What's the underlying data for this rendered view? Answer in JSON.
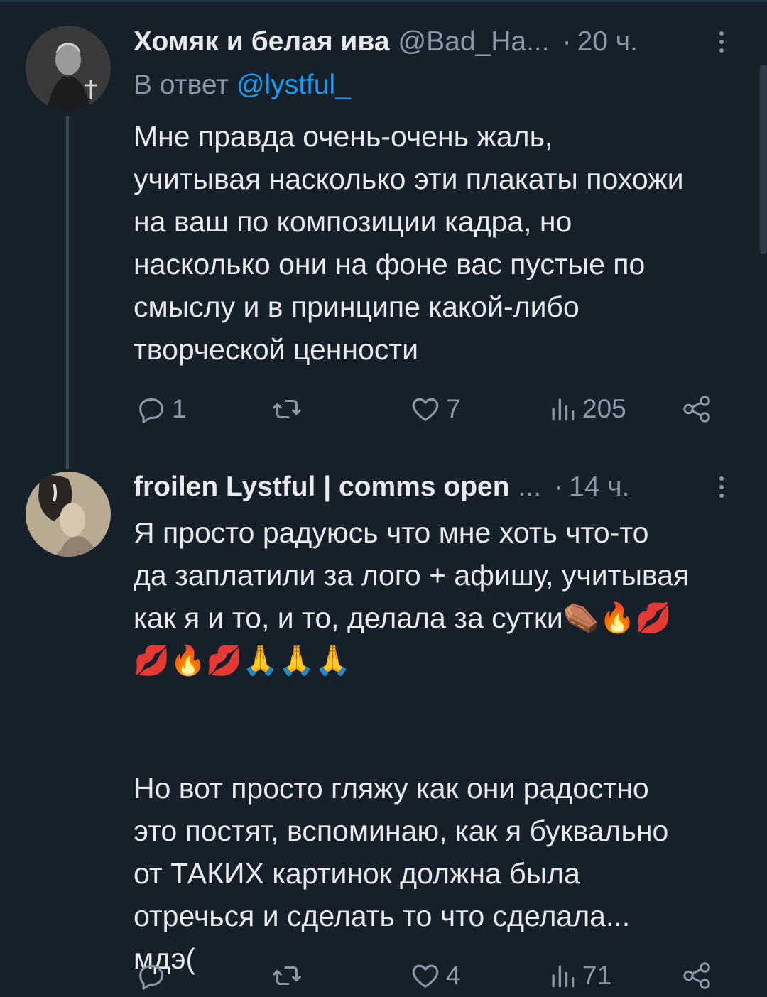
{
  "tweets": [
    {
      "name": "Хомяк и белая ива",
      "handle": "@Bad_Ha...",
      "dot": "·",
      "time": "20 ч.",
      "reply_prefix": "В ответ",
      "reply_mention": "@lystful_",
      "text": "Мне правда очень-очень жаль,\nучитывая насколько эти плакаты похожи\nна ваш по композиции кадра, но\nнасколько они на фоне вас пустые по\nсмыслу и в принципе какой-либо\nтворческой ценности",
      "replies": "1",
      "retweets": "",
      "likes": "7",
      "views": "205"
    },
    {
      "name": "froilen Lystful | comms open",
      "handle": "...",
      "dot": "·",
      "time": "14 ч.",
      "text": "Я просто радуюсь что мне хоть что-то\nда заплатили за лого + афишу, учитывая\nкак я и то, и то, делала за сутки⚰️🔥💋\n💋🔥💋🙏🙏🙏\n\n\nНо вот просто гляжу как они радостно\nэто постят, вспоминаю, как я буквально\nот ТАКИХ картинок должна была\nотречься и сделать то что сделала...\nмдэ(",
      "replies": "",
      "retweets": "",
      "likes": "4",
      "views": "71"
    }
  ],
  "icons": [
    "reply-icon",
    "retweet-icon",
    "like-icon",
    "views-icon",
    "share-icon",
    "more-icon"
  ],
  "colors": {
    "background": "#15202b",
    "text": "#e7e9ea",
    "muted": "#8b98a5",
    "link": "#1d9bf0"
  }
}
